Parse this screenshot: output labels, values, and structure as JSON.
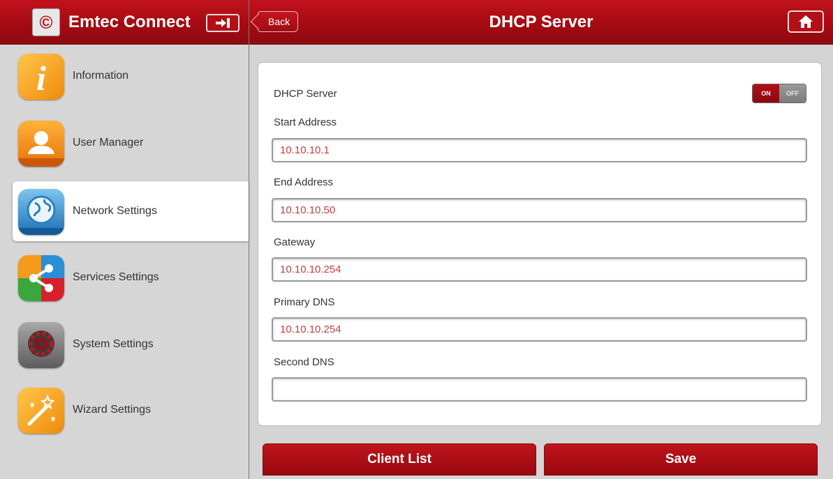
{
  "app": {
    "title": "Emtec Connect",
    "logo_glyph": "©"
  },
  "header": {
    "back_label": "Back",
    "page_title": "DHCP Server"
  },
  "sidebar": {
    "items": [
      {
        "label": "Information",
        "icon": "information-icon"
      },
      {
        "label": "User Manager",
        "icon": "user-icon"
      },
      {
        "label": "Network Settings",
        "icon": "globe-icon",
        "active": true
      },
      {
        "label": "Services Settings",
        "icon": "share-icon"
      },
      {
        "label": "System Settings",
        "icon": "gear-icon"
      },
      {
        "label": "Wizard Settings",
        "icon": "magic-wand-icon"
      }
    ]
  },
  "form": {
    "dhcp_label": "DHCP Server",
    "toggle": {
      "on_label": "ON",
      "off_label": "OFF",
      "state": "on"
    },
    "fields": {
      "start": {
        "label": "Start Address",
        "value": "10.10.10.1"
      },
      "end": {
        "label": "End Address",
        "value": "10.10.10.50"
      },
      "gateway": {
        "label": "Gateway",
        "value": "10.10.10.254"
      },
      "dns1": {
        "label": "Primary DNS",
        "value": "10.10.10.254"
      },
      "dns2": {
        "label": "Second DNS",
        "value": ""
      }
    }
  },
  "buttons": {
    "client_list": "Client List",
    "save": "Save"
  },
  "colors": {
    "header_red": "#b10f17",
    "input_text": "#c2403e",
    "sidebar_bg": "#d6d6d6"
  }
}
